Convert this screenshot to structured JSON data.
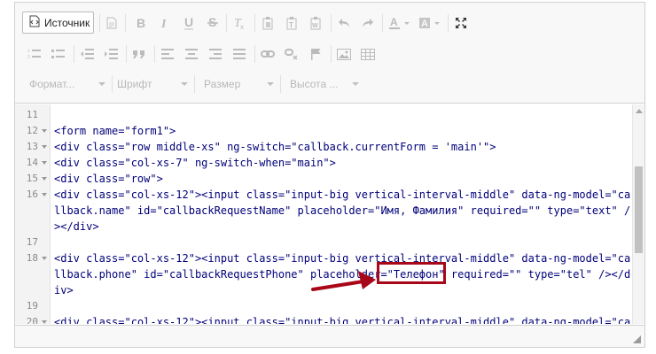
{
  "toolbar": {
    "source_label": "Источник",
    "format_label": "Формат...",
    "font_label": "Шрифт",
    "size_label": "Размер",
    "height_label": "Высота ..."
  },
  "code": {
    "gutter_numbers": [
      "11",
      "12",
      "13",
      "14",
      "15",
      "16",
      "",
      "",
      "17",
      "",
      "18",
      "",
      "",
      "19",
      "",
      "20"
    ],
    "lines": [
      "",
      "<form name=\"form1\">",
      "<div class=\"row middle-xs\" ng-switch=\"callback.currentForm = 'main'\">",
      "<div class=\"col-xs-7\" ng-switch-when=\"main\">",
      "<div class=\"row\">",
      "<div class=\"col-xs-12\"><input class=\"input-big vertical-interval-middle\" data-ng-model=\"ca",
      "llback.name\" id=\"callbackRequestName\" placeholder=\"Имя, Фамилия\" required=\"\" type=\"text\" /",
      "></div>",
      "",
      "<div class=\"col-xs-12\"><input class=\"input-big vertical-interval-middle\" data-ng-model=\"ca",
      "llback.phone\" id=\"callbackRequestPhone\" placeholder=\"Телефон\" required=\"\" type=\"tel\" /></d",
      "iv>",
      "",
      "<div class=\"col-xs-12\"><input class=\"input-big vertical-interval-middle\" data-ng-model=\"ca"
    ]
  },
  "colors": {
    "code_text": "#00007a",
    "annotation_red": "#a8071a",
    "toolbar_bg": "#f8f8f8",
    "gutter_bg": "#f3f3f3"
  }
}
